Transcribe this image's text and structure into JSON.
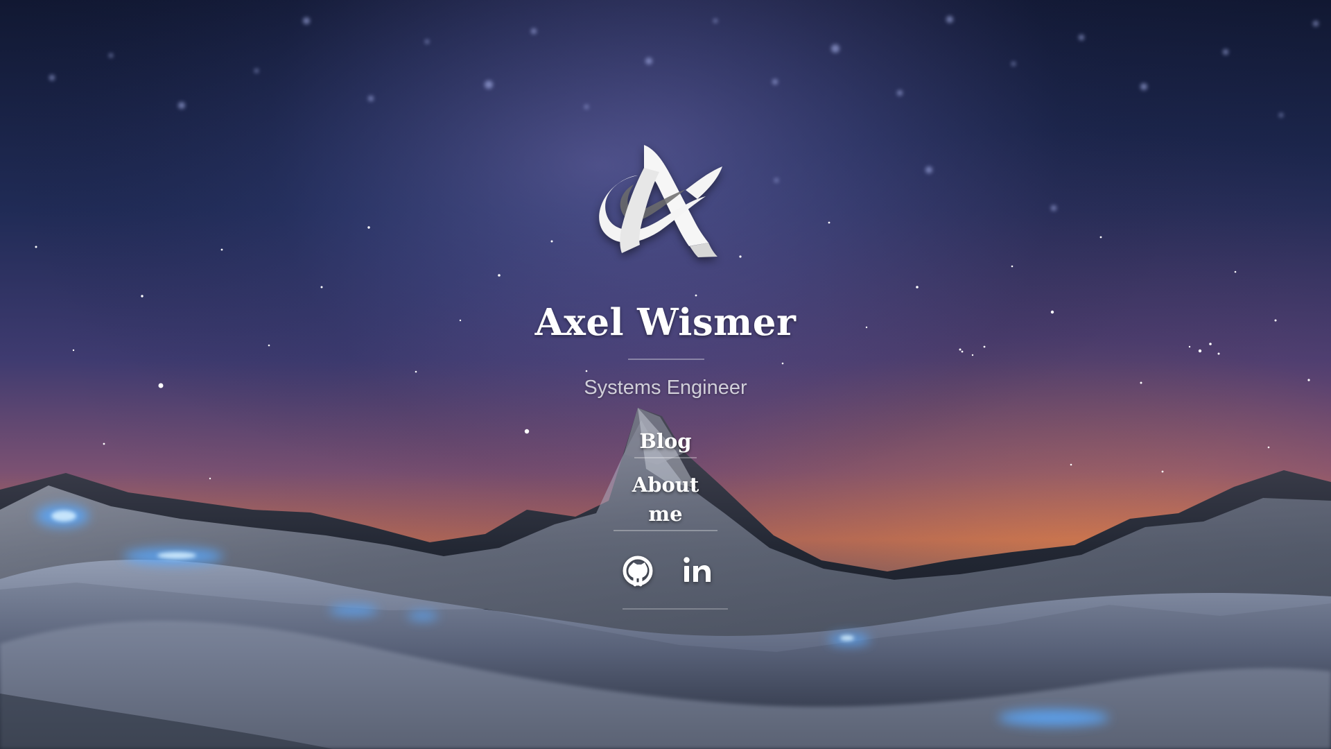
{
  "profile": {
    "name": "Axel Wismer",
    "role": "Systems Engineer"
  },
  "navigation": {
    "links": [
      {
        "label": "Blog"
      },
      {
        "label": "About me"
      }
    ]
  },
  "social": {
    "icons": [
      {
        "name": "github-icon"
      },
      {
        "name": "linkedin-icon"
      }
    ]
  },
  "colors": {
    "text_primary": "#ffffff",
    "text_secondary": "#e8e8ee",
    "accent_blue": "#5aa9ff",
    "sky_top": "#111832",
    "sky_glow": "#b56a54"
  }
}
